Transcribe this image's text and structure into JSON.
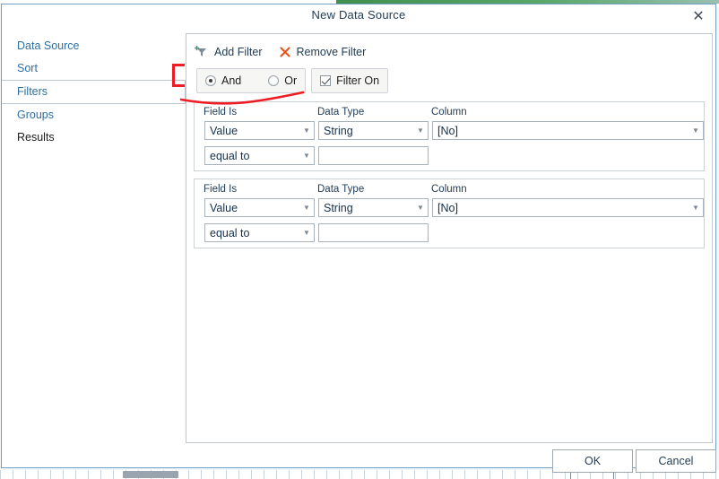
{
  "window": {
    "title": "New Data Source",
    "close_icon": "close-icon",
    "close_glyph": "✕"
  },
  "sidebar": {
    "items": [
      {
        "label": "Data Source",
        "selected": false,
        "muted": false
      },
      {
        "label": "Sort",
        "selected": false,
        "muted": false
      },
      {
        "label": "Filters",
        "selected": true,
        "muted": false
      },
      {
        "label": "Groups",
        "selected": false,
        "muted": false
      },
      {
        "label": "Results",
        "selected": false,
        "muted": true
      }
    ]
  },
  "toolbar": {
    "add_filter_label": "Add Filter",
    "add_filter_icon": "add-filter-funnel-icon",
    "remove_filter_label": "Remove Filter",
    "remove_filter_icon": "remove-filter-x-icon"
  },
  "logic": {
    "and_label": "And",
    "or_label": "Or",
    "and_checked": true,
    "or_checked": false,
    "filter_on_label": "Filter On",
    "filter_on_checked": true
  },
  "labels": {
    "field_is": "Field Is",
    "data_type": "Data Type",
    "column": "Column"
  },
  "filters": [
    {
      "field_is": "Value",
      "data_type": "String",
      "column": "[No]",
      "operator": "equal to",
      "value": "",
      "value_placeholder": ""
    },
    {
      "field_is": "Value",
      "data_type": "String",
      "column": "[No]",
      "operator": "equal to",
      "value": "",
      "value_placeholder": ""
    }
  ],
  "footer": {
    "ok_label": "OK",
    "cancel_label": "Cancel"
  },
  "colors": {
    "accent_border": "#6f9fc2",
    "link_text": "#2f6f9f",
    "annotation_red": "#ee1c25",
    "add_icon_green": "#4e9b7f",
    "remove_icon_orange": "#e2581f"
  },
  "annotations": {
    "bracket": "red-bracket-annotation",
    "underline": "red-underline-annotation"
  }
}
